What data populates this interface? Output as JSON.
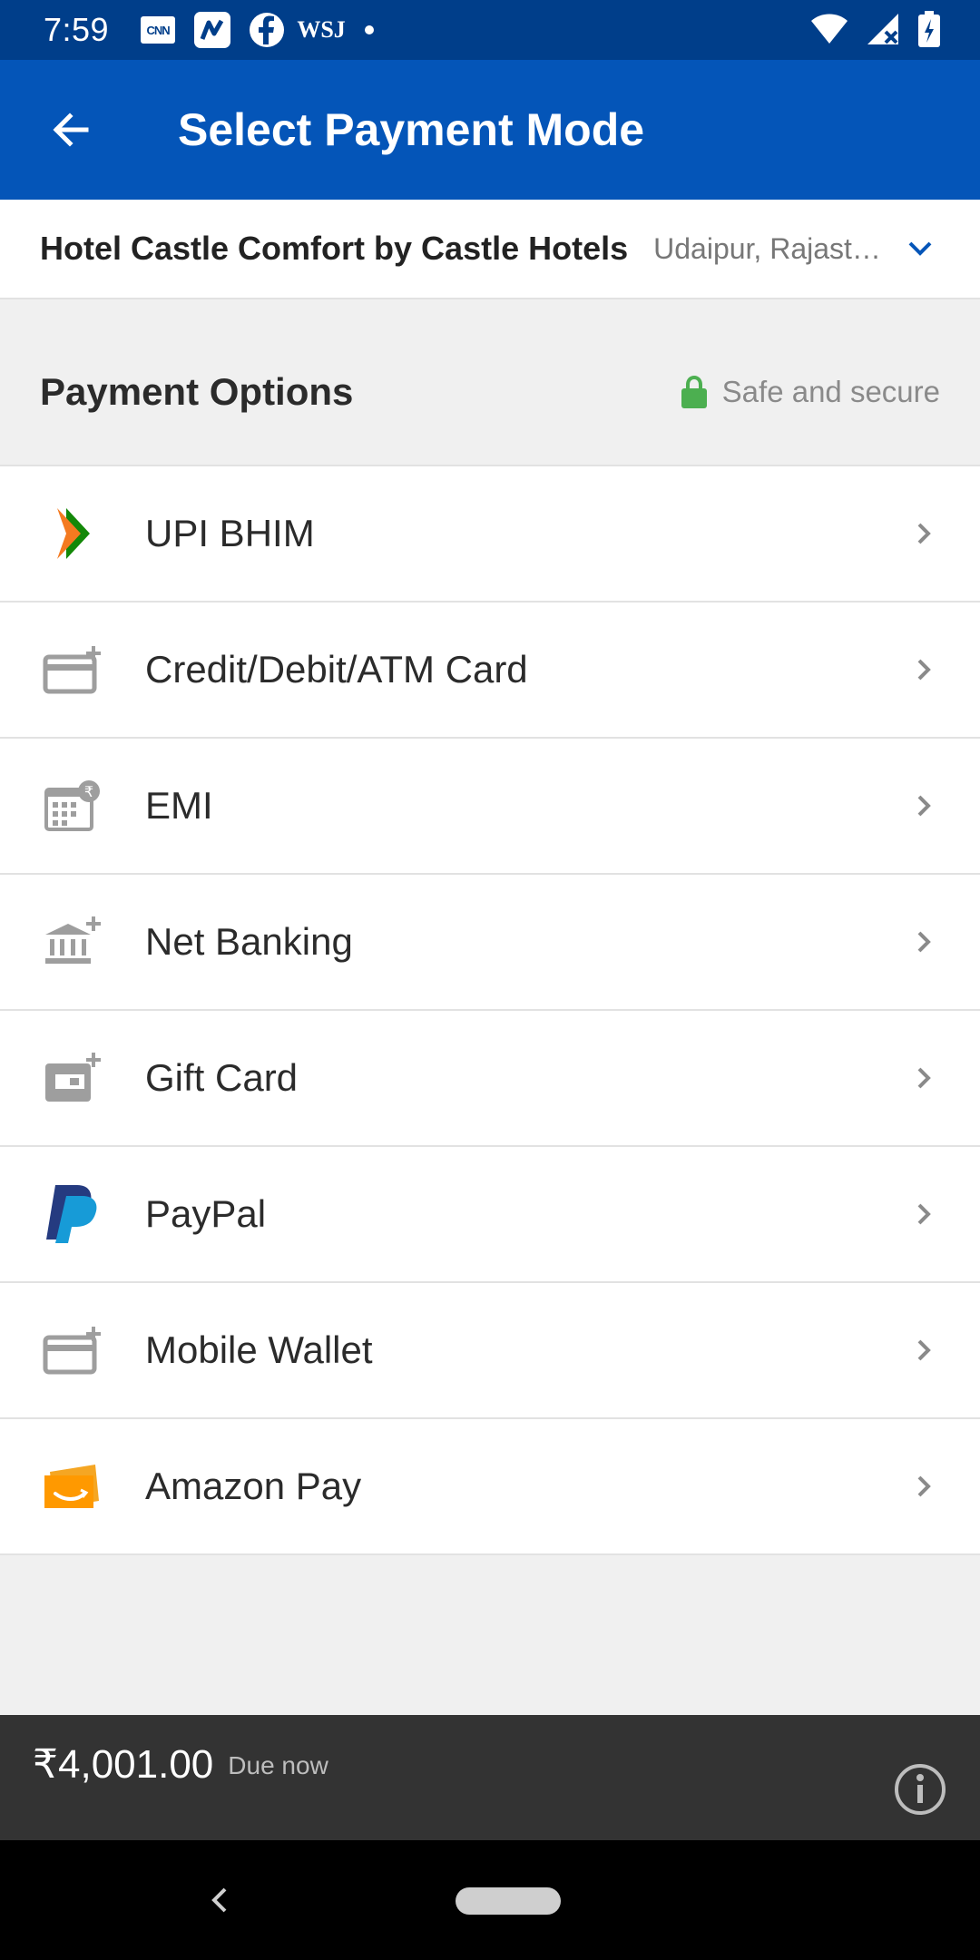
{
  "status_bar": {
    "time": "7:59",
    "apps": [
      "CNN",
      "news-app",
      "Facebook",
      "WSJ"
    ],
    "wsj_label": "WSJ",
    "cnn_label": "CNN"
  },
  "app_bar": {
    "title": "Select Payment Mode",
    "back_icon": "arrow-left-icon"
  },
  "hotel": {
    "name": "Hotel Castle Comfort by Castle Hotels",
    "location": "Udaipur, Rajasthan"
  },
  "payment_header": {
    "title": "Payment Options",
    "secure_text": "Safe and secure"
  },
  "payment_options": [
    {
      "label": "UPI BHIM",
      "icon": "bhim-logo"
    },
    {
      "label": "Credit/Debit/ATM Card",
      "icon": "card-add-icon"
    },
    {
      "label": "EMI",
      "icon": "emi-calendar-icon"
    },
    {
      "label": "Net Banking",
      "icon": "bank-add-icon"
    },
    {
      "label": "Gift Card",
      "icon": "gift-card-add-icon"
    },
    {
      "label": "PayPal",
      "icon": "paypal-logo"
    },
    {
      "label": "Mobile Wallet",
      "icon": "wallet-add-icon"
    },
    {
      "label": "Amazon Pay",
      "icon": "amazon-pay-logo"
    }
  ],
  "footer": {
    "amount": "₹4,001.00",
    "due_label": "Due now"
  },
  "colors": {
    "status_bar": "#003e8a",
    "app_bar": "#0455b8",
    "accent": "#0455b8",
    "secure_lock": "#4caf50",
    "footer": "#333333"
  }
}
